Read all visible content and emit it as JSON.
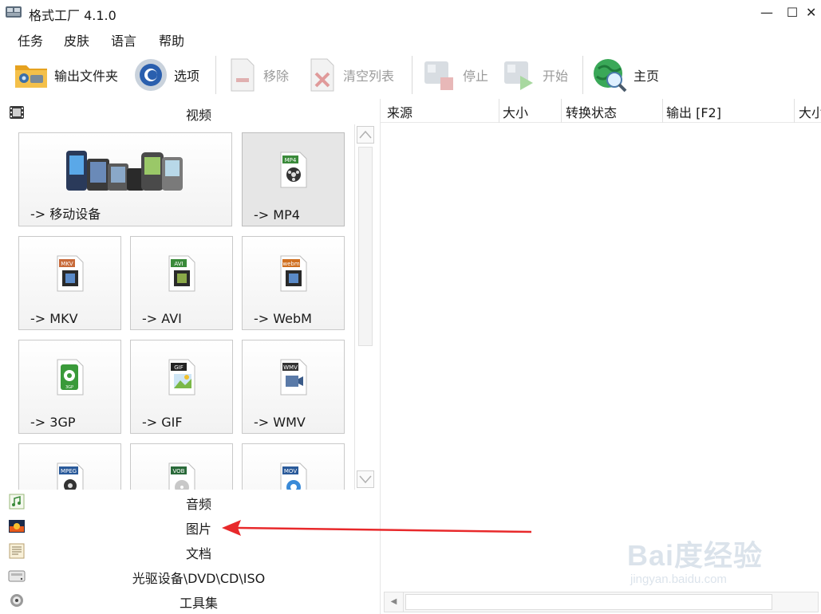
{
  "window": {
    "title": "格式工厂 4.1.0",
    "controls": {
      "minimize": "—",
      "maximize": "☐",
      "close": "✕"
    }
  },
  "menu": [
    "任务",
    "皮肤",
    "语言",
    "帮助"
  ],
  "toolbar": {
    "output_folder": "输出文件夹",
    "options": "选项",
    "remove": "移除",
    "clear_list": "清空列表",
    "stop": "停止",
    "start": "开始",
    "home": "主页"
  },
  "left_panel": {
    "video_category": "视频",
    "tiles": [
      {
        "label": "-> 移动设备",
        "icon": "mobile-devices-icon",
        "selected": false
      },
      {
        "label": "-> MP4",
        "icon": "mp4-file-icon",
        "badge": "MP4",
        "badge_color": "#3a8a3a",
        "selected": true
      },
      {
        "label": "-> MKV",
        "icon": "mkv-file-icon",
        "badge": "MKV",
        "badge_color": "#c86a3a",
        "selected": false
      },
      {
        "label": "-> AVI",
        "icon": "avi-file-icon",
        "badge": "AVI",
        "badge_color": "#3a8a3a",
        "selected": false
      },
      {
        "label": "-> WebM",
        "icon": "webm-file-icon",
        "badge": "webm",
        "badge_color": "#d07020",
        "selected": false
      },
      {
        "label": "-> 3GP",
        "icon": "3gp-file-icon",
        "badge": "3GP",
        "badge_color": "#3a9a3a",
        "selected": false
      },
      {
        "label": "-> GIF",
        "icon": "gif-file-icon",
        "badge": "GIF",
        "badge_color": "#222222",
        "selected": false
      },
      {
        "label": "-> WMV",
        "icon": "wmv-file-icon",
        "badge": "WMV",
        "badge_color": "#333333",
        "selected": false
      },
      {
        "label": "",
        "icon": "mpeg-file-icon",
        "badge": "MPEG",
        "badge_color": "#2a5a9a",
        "selected": false
      },
      {
        "label": "",
        "icon": "vob-file-icon",
        "badge": "VOB",
        "badge_color": "#2a6a3a",
        "selected": false
      },
      {
        "label": "",
        "icon": "mov-file-icon",
        "badge": "MOV",
        "badge_color": "#2a5a9a",
        "selected": false
      }
    ],
    "categories": [
      {
        "label": "音频",
        "icon": "audio-icon"
      },
      {
        "label": "图片",
        "icon": "picture-icon"
      },
      {
        "label": "文档",
        "icon": "document-icon"
      },
      {
        "label": "光驱设备\\DVD\\CD\\ISO",
        "icon": "disc-drive-icon"
      },
      {
        "label": "工具集",
        "icon": "toolbox-icon"
      }
    ]
  },
  "task_list": {
    "columns": [
      "来源",
      "大小",
      "转换状态",
      "输出 [F2]",
      "大小"
    ]
  },
  "watermark": {
    "main": "Bai度经验",
    "sub": "jingyan.baidu.com"
  },
  "colors": {
    "annotation_arrow": "#e8292b",
    "disabled_text": "#9a9a9a"
  }
}
